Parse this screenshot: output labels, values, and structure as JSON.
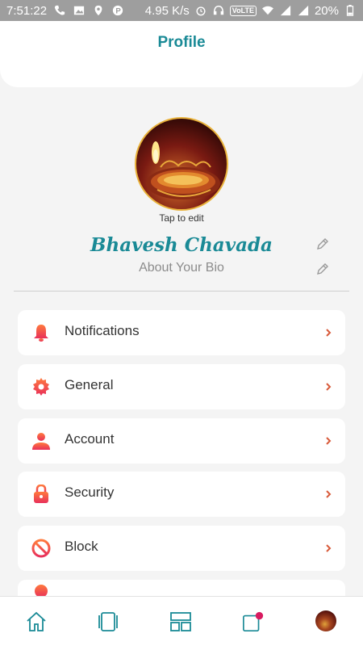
{
  "status_bar": {
    "time": "7:51:22",
    "speed": "4.95 K/s",
    "volte": "VoLTE",
    "battery": "20%"
  },
  "header": {
    "title": "Profile"
  },
  "profile": {
    "tap_to_edit": "Tap to edit",
    "name": "Bhavesh Chavada",
    "bio": "About Your Bio"
  },
  "menu": [
    {
      "label": "Notifications",
      "icon": "bell-icon"
    },
    {
      "label": "General",
      "icon": "gear-icon"
    },
    {
      "label": "Account",
      "icon": "user-icon"
    },
    {
      "label": "Security",
      "icon": "lock-icon"
    },
    {
      "label": "Block",
      "icon": "block-icon"
    }
  ],
  "colors": {
    "accent": "#1a8a96",
    "icon_gradient_top": "#ff7a3d",
    "icon_gradient_bottom": "#e8305a",
    "chevron": "#d85a3a",
    "notification_dot": "#d81b60"
  }
}
